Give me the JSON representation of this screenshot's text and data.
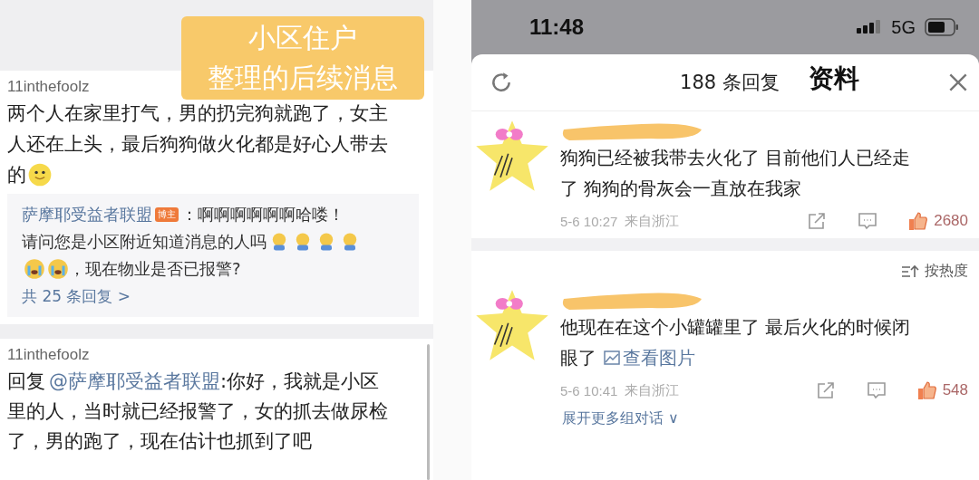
{
  "caption": {
    "lines": [
      "小区住户",
      "整理的后续消息"
    ]
  },
  "left_thread": {
    "comment": {
      "author": "11inthefoolz",
      "lines": [
        [
          {
            "kind": "text",
            "text": "两个人在家里打气，男的扔完狗就跑了，女主"
          }
        ],
        [
          {
            "kind": "text",
            "text": "人还在上头，最后狗狗做火化都是好心人带去"
          }
        ],
        [
          {
            "kind": "text",
            "text": "的"
          },
          {
            "kind": "smile"
          }
        ]
      ],
      "reply": {
        "lines": [
          [
            {
              "kind": "author",
              "text": "萨摩耶受益者联盟"
            },
            {
              "kind": "badge",
              "text": "博主"
            },
            {
              "kind": "text",
              "text": "：啊啊啊啊啊啊哈喽！"
            }
          ],
          [
            {
              "kind": "text",
              "text": "请问您是小区附近知道消息的人吗"
            },
            {
              "kind": "weep"
            },
            {
              "kind": "weep"
            },
            {
              "kind": "weep"
            },
            {
              "kind": "weep"
            }
          ],
          [
            {
              "kind": "sob"
            },
            {
              "kind": "sob"
            },
            {
              "kind": "text",
              "text": "，现在物业是否已报警?"
            }
          ]
        ],
        "more_link": "共 25 条回复 >"
      }
    },
    "second": {
      "author": "11inthefoolz",
      "lines": [
        [
          {
            "kind": "text",
            "text": "回复"
          },
          {
            "kind": "mention",
            "text": "@萨摩耶受益者联盟"
          },
          {
            "kind": "text",
            "text": ":你好，我就是小区"
          }
        ],
        [
          {
            "kind": "text",
            "text": "里的人，当时就已经报警了，女的抓去做尿检"
          }
        ],
        [
          {
            "kind": "text",
            "text": "了，男的跑了，现在估计也抓到了吧"
          }
        ]
      ]
    }
  },
  "status_bar": {
    "time": "11:48",
    "network": "5G"
  },
  "sheet": {
    "title": "188 条回复",
    "overlay_label": "资料",
    "comments": [
      {
        "lines": [
          [
            {
              "kind": "text",
              "text": "狗狗已经被我带去火化了 目前他们人已经走"
            }
          ],
          [
            {
              "kind": "text",
              "text": "了 狗狗的骨灰会一直放在我家"
            }
          ]
        ],
        "time": "5-6 10:27",
        "location": "来自浙江",
        "likes": "2680"
      },
      {
        "lines": [
          [
            {
              "kind": "text",
              "text": "他现在在这个小罐罐里了 最后火化的时候闭"
            }
          ],
          [
            {
              "kind": "text",
              "text": "眼了"
            },
            {
              "kind": "image_link",
              "text": "查看图片"
            }
          ]
        ],
        "time": "5-6 10:41",
        "location": "来自浙江",
        "likes": "548"
      }
    ],
    "sort_label": "按热度",
    "expand_link": "展开更多组对话 ∨"
  }
}
